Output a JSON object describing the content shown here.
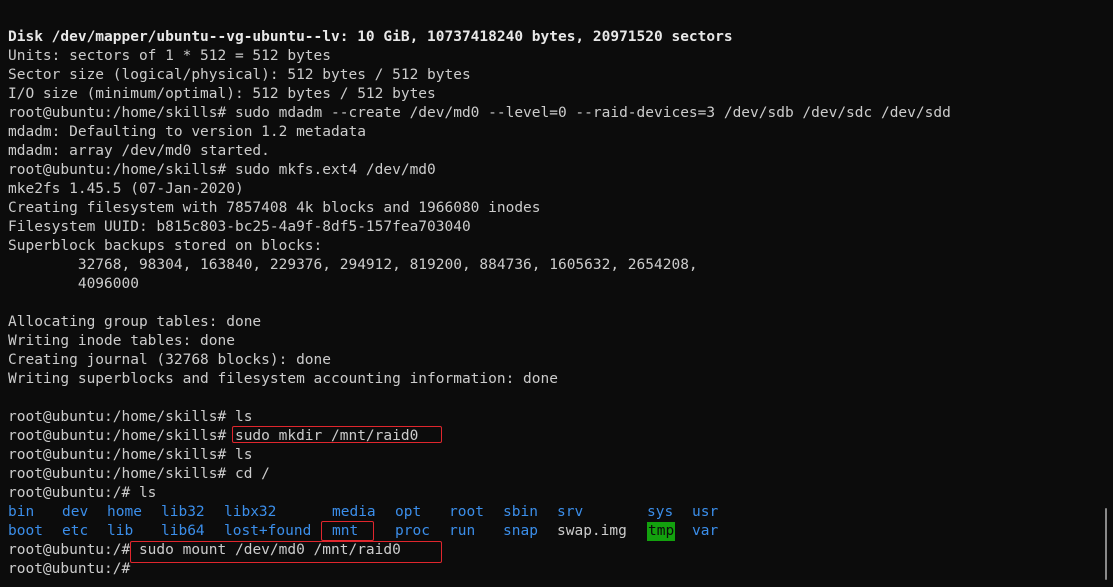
{
  "terminal": {
    "lines": [
      "Disk /dev/mapper/ubuntu--vg-ubuntu--lv: 10 GiB, 10737418240 bytes, 20971520 sectors",
      "Units: sectors of 1 * 512 = 512 bytes",
      "Sector size (logical/physical): 512 bytes / 512 bytes",
      "I/O size (minimum/optimal): 512 bytes / 512 bytes",
      "root@ubuntu:/home/skills# sudo mdadm --create /dev/md0 --level=0 --raid-devices=3 /dev/sdb /dev/sdc /dev/sdd",
      "mdadm: Defaulting to version 1.2 metadata",
      "mdadm: array /dev/md0 started.",
      "root@ubuntu:/home/skills# sudo mkfs.ext4 /dev/md0",
      "mke2fs 1.45.5 (07-Jan-2020)",
      "Creating filesystem with 7857408 4k blocks and 1966080 inodes",
      "Filesystem UUID: b815c803-bc25-4a9f-8df5-157fea703040",
      "Superblock backups stored on blocks:",
      "        32768, 98304, 163840, 229376, 294912, 819200, 884736, 1605632, 2654208,",
      "        4096000",
      "",
      "Allocating group tables: done",
      "Writing inode tables: done",
      "Creating journal (32768 blocks): done",
      "Writing superblocks and filesystem accounting information: done",
      "",
      "root@ubuntu:/home/skills# ls",
      "root@ubuntu:/home/skills# sudo mkdir /mnt/raid0",
      "root@ubuntu:/home/skills# ls",
      "root@ubuntu:/home/skills# cd /",
      "root@ubuntu:/# ls"
    ],
    "ls_output": {
      "row1": [
        {
          "name": "bin",
          "kind": "dir"
        },
        {
          "name": "dev",
          "kind": "dir"
        },
        {
          "name": "home",
          "kind": "dir"
        },
        {
          "name": "lib32",
          "kind": "dir"
        },
        {
          "name": "libx32",
          "kind": "dir"
        },
        {
          "name": "media",
          "kind": "dir"
        },
        {
          "name": "opt",
          "kind": "dir"
        },
        {
          "name": "root",
          "kind": "dir"
        },
        {
          "name": "sbin",
          "kind": "dir"
        },
        {
          "name": "srv",
          "kind": "dir"
        },
        {
          "name": "sys",
          "kind": "dir"
        },
        {
          "name": "usr",
          "kind": "dir"
        }
      ],
      "row2": [
        {
          "name": "boot",
          "kind": "dir"
        },
        {
          "name": "etc",
          "kind": "dir"
        },
        {
          "name": "lib",
          "kind": "dir"
        },
        {
          "name": "lib64",
          "kind": "dir"
        },
        {
          "name": "lost+found",
          "kind": "dir"
        },
        {
          "name": "mnt",
          "kind": "dir"
        },
        {
          "name": "proc",
          "kind": "dir"
        },
        {
          "name": "run",
          "kind": "dir"
        },
        {
          "name": "snap",
          "kind": "dir"
        },
        {
          "name": "swap.img",
          "kind": "file"
        },
        {
          "name": "tmp",
          "kind": "sticky"
        },
        {
          "name": "var",
          "kind": "dir"
        }
      ]
    },
    "mount_prompt": "root@ubuntu:/# ",
    "mount_command": "sudo mount /dev/md0 /mnt/raid0",
    "final_prompt": "root@ubuntu:/# ",
    "colors": {
      "background": "#0c0c0c",
      "text": "#cccccc",
      "directory": "#3b8eea",
      "sticky_bg": "#13a10e",
      "highlight_box": "#e0262d"
    }
  }
}
